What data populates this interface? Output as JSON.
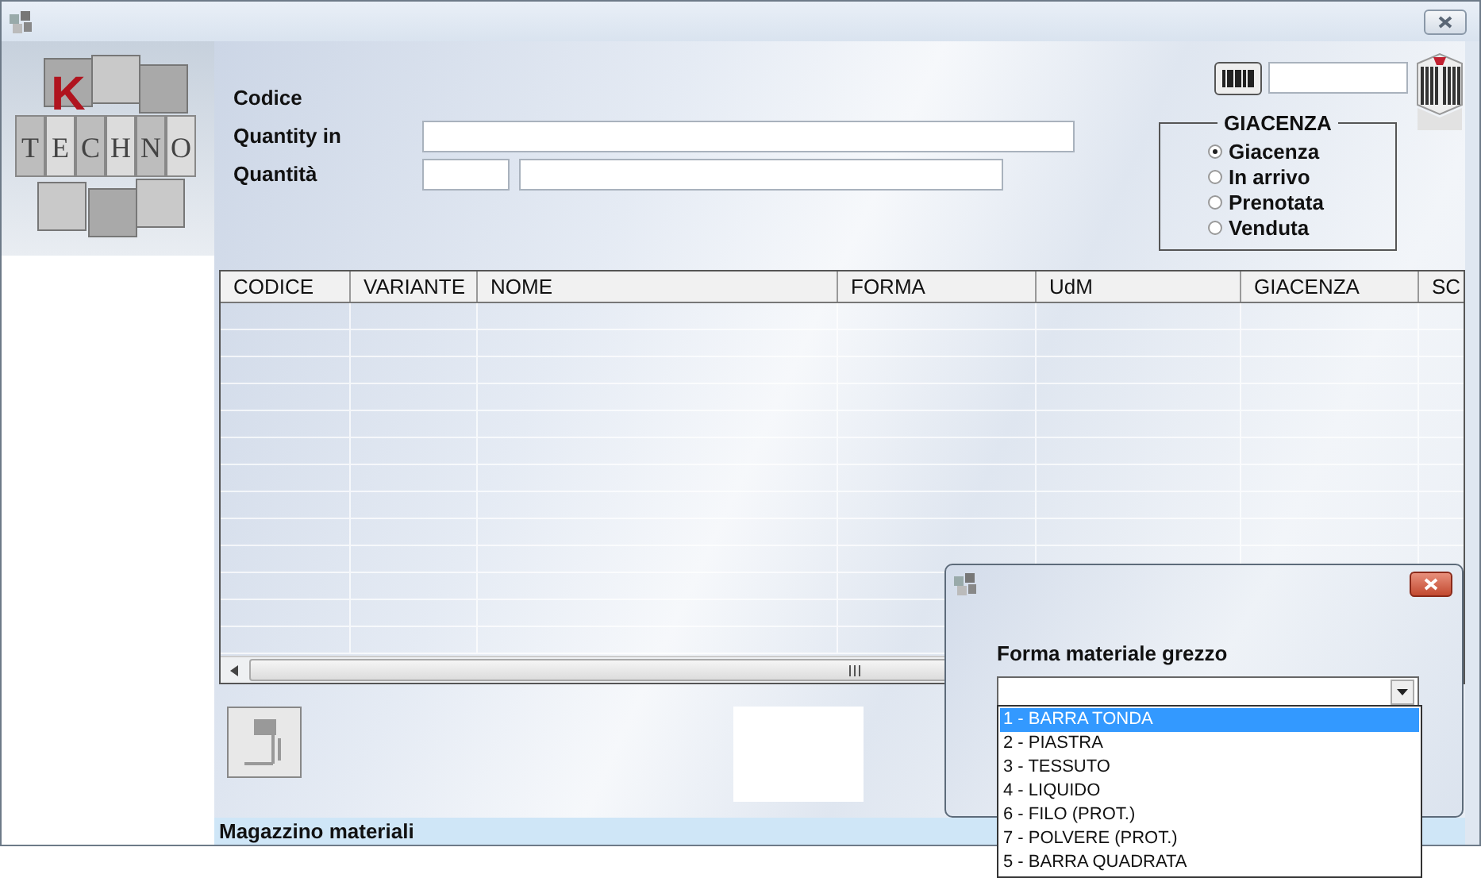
{
  "logo": {
    "mark": "K",
    "letters": [
      "T",
      "E",
      "C",
      "H",
      "N",
      "O"
    ]
  },
  "form": {
    "labels": [
      "Codice",
      "Quantity in",
      "Quantità"
    ]
  },
  "stock_group": {
    "title": "GIACENZA",
    "options": [
      {
        "label": "Giacenza",
        "selected": true
      },
      {
        "label": "In arrivo",
        "selected": false
      },
      {
        "label": "Prenotata",
        "selected": false
      },
      {
        "label": "Venduta",
        "selected": false
      }
    ]
  },
  "table": {
    "columns": [
      "CODICE",
      "VARIANTE",
      "NOME",
      "FORMA",
      "UdM",
      "GIACENZA",
      "SC"
    ]
  },
  "status_bar": "Magazzino materiali",
  "dialog": {
    "label": "Forma materiale grezzo",
    "options": [
      {
        "label": "1 - BARRA TONDA",
        "selected": true
      },
      {
        "label": "2 - PIASTRA",
        "selected": false
      },
      {
        "label": "3 - TESSUTO",
        "selected": false
      },
      {
        "label": "4 - LIQUIDO",
        "selected": false
      },
      {
        "label": "6 - FILO (PROT.)",
        "selected": false
      },
      {
        "label": "7 - POLVERE (PROT.)",
        "selected": false
      },
      {
        "label": "5 - BARRA QUADRATA",
        "selected": false
      }
    ]
  }
}
